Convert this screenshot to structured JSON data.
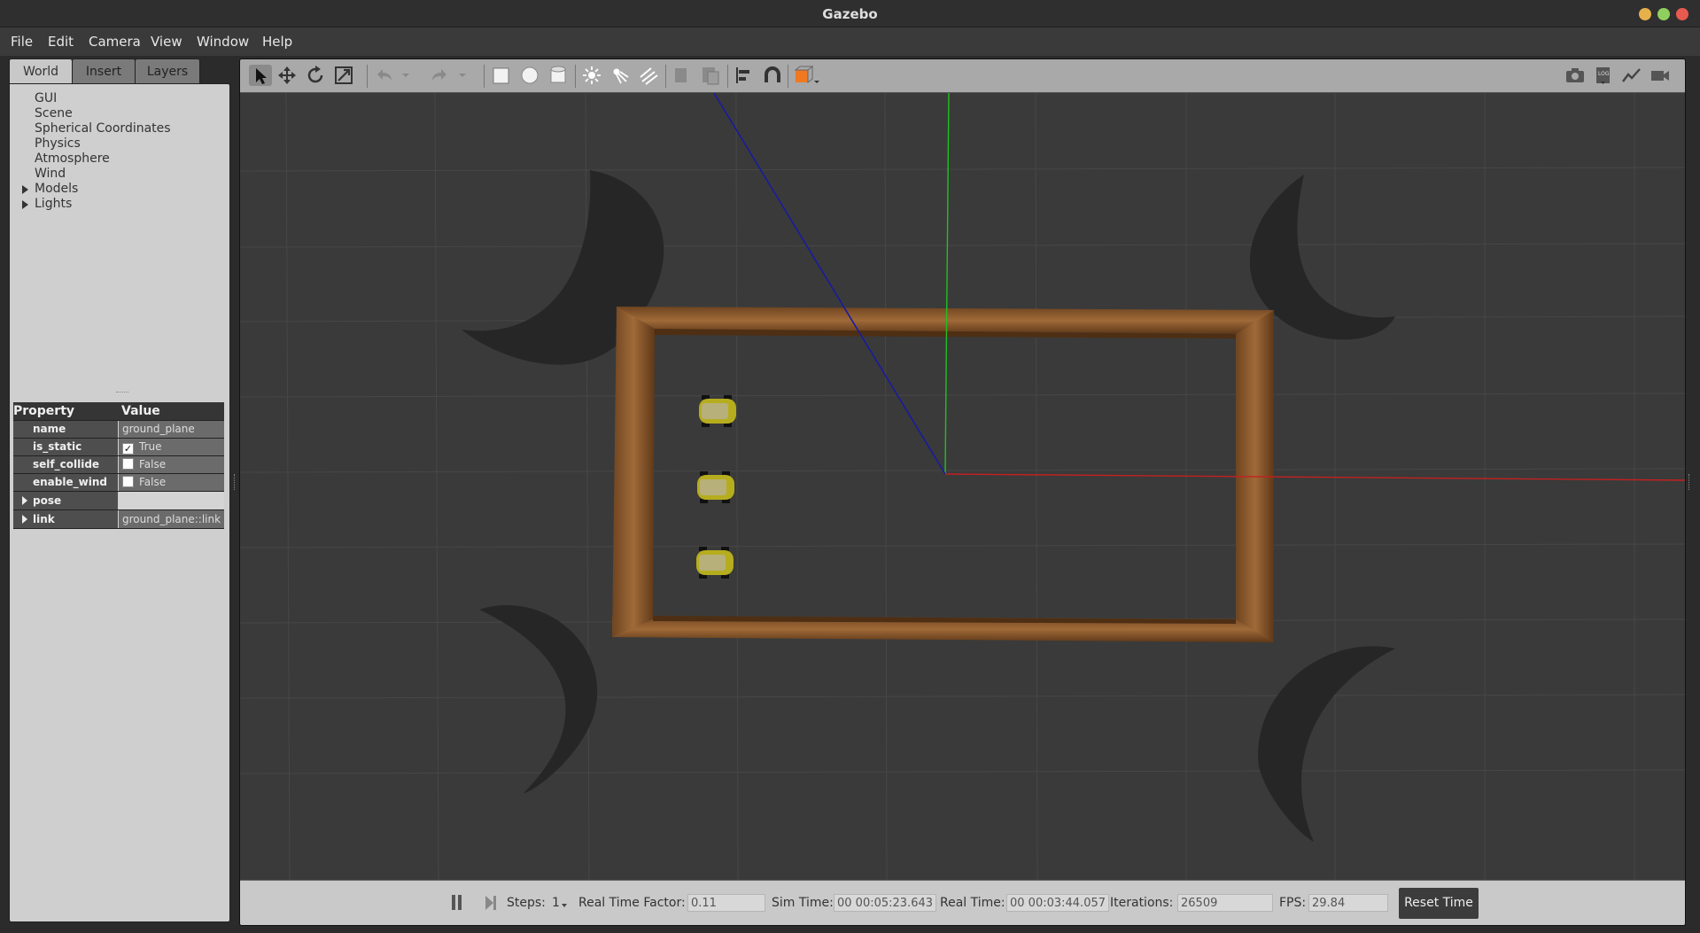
{
  "window": {
    "title": "Gazebo"
  },
  "menu": [
    "File",
    "Edit",
    "Camera",
    "View",
    "Window",
    "Help"
  ],
  "tabs": [
    "World",
    "Insert",
    "Layers"
  ],
  "tree": [
    {
      "label": "GUI",
      "expandable": false
    },
    {
      "label": "Scene",
      "expandable": false
    },
    {
      "label": "Spherical Coordinates",
      "expandable": false
    },
    {
      "label": "Physics",
      "expandable": false
    },
    {
      "label": "Atmosphere",
      "expandable": false
    },
    {
      "label": "Wind",
      "expandable": false
    },
    {
      "label": "Models",
      "expandable": true
    },
    {
      "label": "Lights",
      "expandable": true
    }
  ],
  "properties": {
    "header": {
      "property": "Property",
      "value": "Value"
    },
    "rows": [
      {
        "name": "name",
        "value": "ground_plane"
      },
      {
        "name": "is_static",
        "value": "True",
        "checked": true
      },
      {
        "name": "self_collide",
        "value": "False",
        "checked": false
      },
      {
        "name": "enable_wind",
        "value": "False",
        "checked": false
      },
      {
        "name": "pose",
        "value": "",
        "expandable": true
      },
      {
        "name": "link",
        "value": "ground_plane::link",
        "expandable": true
      }
    ]
  },
  "toolbar": {
    "tools": [
      "select-icon",
      "translate-icon",
      "rotate-icon",
      "scale-icon",
      "undo-icon",
      "redo-icon",
      "box-icon",
      "sphere-icon",
      "cylinder-icon",
      "point-light-icon",
      "spot-light-icon",
      "directional-light-icon",
      "copy-icon",
      "paste-icon",
      "align-icon",
      "snap-icon",
      "view-angle-icon"
    ],
    "right_tools": [
      "screenshot-icon",
      "log-icon",
      "plot-icon",
      "record-video-icon"
    ]
  },
  "status": {
    "steps_label": "Steps:",
    "steps_value": "1",
    "rtf_label": "Real Time Factor:",
    "rtf_value": "0.11",
    "sim_label": "Sim Time:",
    "sim_value": "00 00:05:23.643",
    "real_label": "Real Time:",
    "real_value": "00 00:03:44.057",
    "iter_label": "Iterations:",
    "iter_value": "26509",
    "fps_label": "FPS:",
    "fps_value": "29.84",
    "reset_label": "Reset Time"
  },
  "colors": {
    "x_axis": "#cc2222",
    "y_axis": "#22cc22",
    "z_axis": "#2222aa",
    "wall": "#8b5a2b",
    "robot": "#b8b020"
  }
}
